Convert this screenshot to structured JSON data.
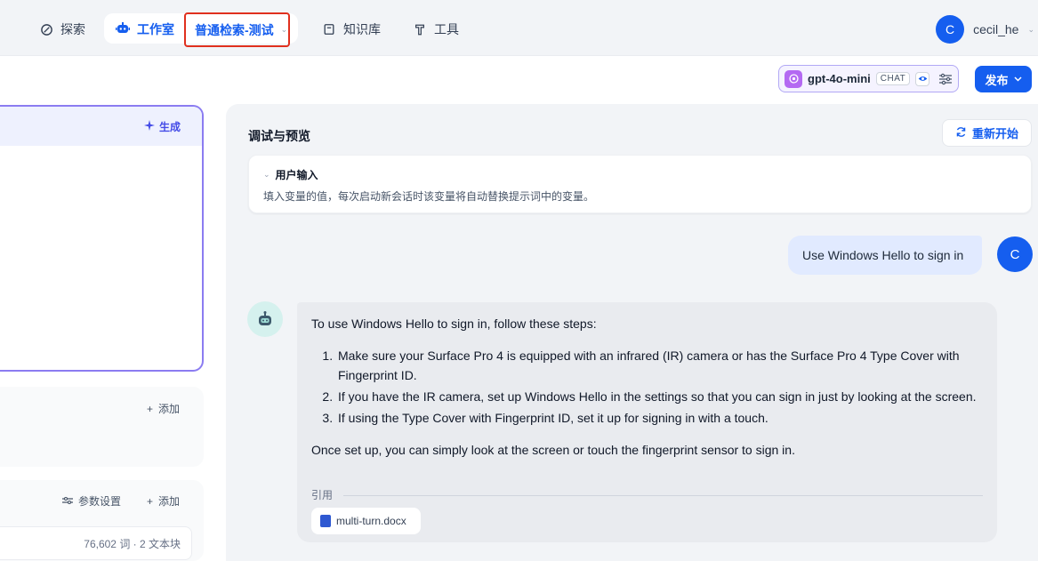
{
  "nav": {
    "explore": "探索",
    "studio": "工作室",
    "app_name": "普通检索-测试",
    "knowledge": "知识库",
    "tools": "工具"
  },
  "user": {
    "avatar_letter": "C",
    "name": "cecil_he"
  },
  "model": {
    "name": "gpt-4o-mini",
    "mode_badge": "CHAT"
  },
  "publish_label": "发布",
  "left": {
    "generate_label": "生成",
    "add_label_1": "添加",
    "param_settings_label": "参数设置",
    "add_label_2": "添加",
    "dataset_meta": "76,602 词 · 2 文本块"
  },
  "debug": {
    "title": "调试与预览",
    "restart_label": "重新开始",
    "user_input_title": "用户输入",
    "user_input_desc": "填入变量的值，每次启动新会话时该变量将自动替换提示词中的变量。"
  },
  "chat": {
    "question": "Use Windows Hello to sign in",
    "user_avatar_letter": "C",
    "answer_intro": "To use Windows Hello to sign in, follow these steps:",
    "answer_steps": [
      "Make sure your Surface Pro 4 is equipped with an infrared (IR) camera or has the Surface Pro 4 Type Cover with Fingerprint ID.",
      "If you have the IR camera, set up Windows Hello in the settings so that you can sign in just by looking at the screen.",
      "If using the Type Cover with Fingerprint ID, set it up for signing in with a touch."
    ],
    "answer_outro": "Once set up, you can simply look at the screen or touch the fingerprint sensor to sign in.",
    "citation_label": "引用",
    "citation_file": "multi-turn.docx"
  },
  "colors": {
    "accent": "#155eef",
    "highlight_border": "#e0301e",
    "prompt_border": "#8b7cf1"
  },
  "icons": [
    "explore-icon",
    "robot-icon",
    "book-icon",
    "tool-icon",
    "openai-icon",
    "eye-icon",
    "sliders-icon",
    "sparkle-icon",
    "plus-icon",
    "refresh-icon",
    "bot-avatar-icon",
    "doc-icon"
  ]
}
